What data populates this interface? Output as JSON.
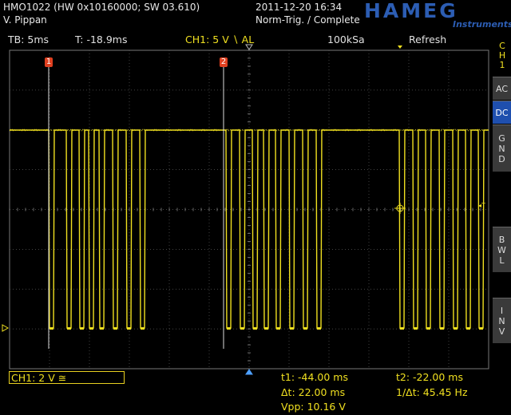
{
  "header": {
    "device": "HMO1022 (HW 0x10160000; SW 03.610)",
    "user": "V. Pippan",
    "datetime": "2011-12-20 16:34",
    "trigger_state": "Norm-Trig. / Complete",
    "logo": "HAMEG",
    "logo_sub": "Instruments"
  },
  "info_bar": {
    "timebase": "TB: 5ms",
    "trigger_time": "T: -18.9ms",
    "channel_setting": "CH1: 5 V ∖ AL",
    "sample_rate": "100kSa",
    "mode": "Refresh"
  },
  "side_menu": {
    "channel_label": [
      "C",
      "H",
      "1"
    ],
    "buttons": [
      {
        "label": [
          "AC"
        ],
        "active": false
      },
      {
        "label": [
          "DC"
        ],
        "active": true
      },
      {
        "label": [
          "G",
          "N",
          "D"
        ],
        "active": false
      },
      {
        "label": [
          "B",
          "W",
          "L"
        ],
        "active": false
      },
      {
        "label": [
          "I",
          "N",
          "V"
        ],
        "active": false
      }
    ]
  },
  "cursors": {
    "c1_label": "1",
    "c2_label": "2",
    "trigger_marker": "T"
  },
  "bottom": {
    "channel_scale": "CH1: 2 V ≅",
    "t1": "t1: -44.00 ms",
    "t2": "t2: -22.00 ms",
    "dt": "Δt: 22.00 ms",
    "inv_dt": "1/Δt: 45.45 Hz",
    "vpp": "Vpp: 10.16 V"
  },
  "colors": {
    "trace": "#f0e020",
    "grid": "#5a5a5a",
    "cursor_marker": "#e04020",
    "accent": "#1f4fae"
  }
}
